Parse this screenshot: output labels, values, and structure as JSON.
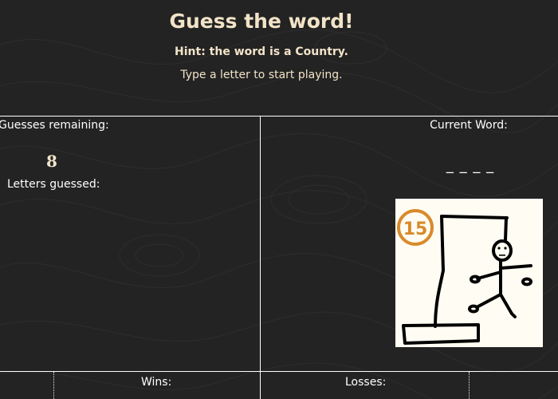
{
  "header": {
    "title": "Guess the word!",
    "hint": "Hint: the word is a Country.",
    "instructions": "Type a letter to start playing."
  },
  "stats": {
    "guesses_remaining_label": "Guesses remaining:",
    "guesses_remaining": "8",
    "letters_guessed_label": "Letters guessed:",
    "letters_guessed": ""
  },
  "word": {
    "label": "Current Word:",
    "display": "_ _ _ _"
  },
  "hangman": {
    "stage_number": "15",
    "accent_color": "#d98a2b"
  },
  "footer": {
    "wins_label": "Wins:",
    "losses_label": "Losses:"
  }
}
